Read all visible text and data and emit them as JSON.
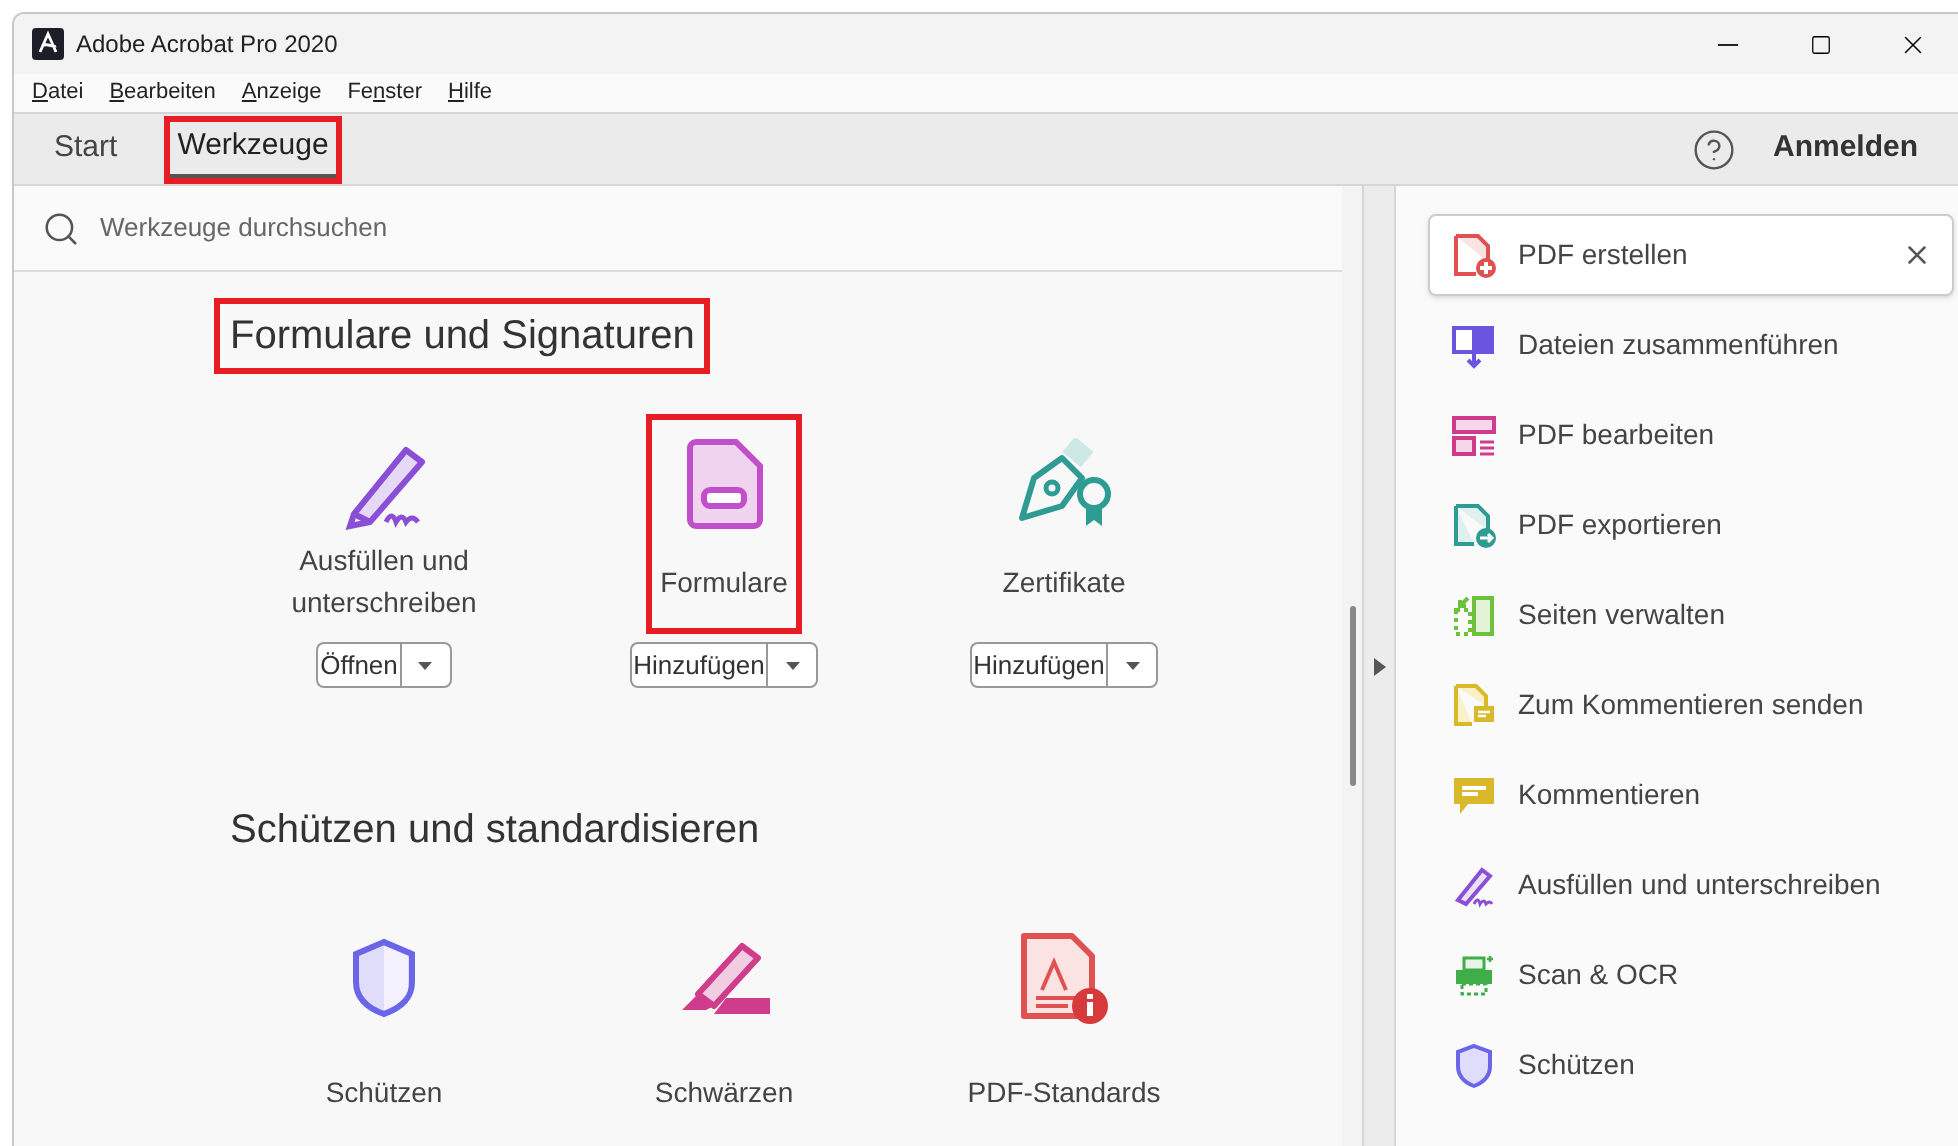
{
  "window": {
    "title": "Adobe Acrobat Pro 2020"
  },
  "menu": [
    {
      "mnemonic": "D",
      "after": "atei"
    },
    {
      "mnemonic": "B",
      "after": "earbeiten"
    },
    {
      "mnemonic": "A",
      "after": "nzeige"
    },
    {
      "before": "Fe",
      "mnemonic": "n",
      "after": "ster"
    },
    {
      "mnemonic": "H",
      "after": "ilfe"
    }
  ],
  "tabs": [
    {
      "label": "Start",
      "selected": false,
      "highlighted": false
    },
    {
      "label": "Werkzeuge",
      "selected": true,
      "highlighted": true
    }
  ],
  "sign_in": "Anmelden",
  "search": {
    "placeholder": "Werkzeuge durchsuchen"
  },
  "sections": [
    {
      "title": "Formulare und Signaturen",
      "highlighted": true,
      "tools": [
        {
          "label": "Ausfüllen und unterschreiben",
          "button": "Öffnen",
          "highlighted": false
        },
        {
          "label": "Formulare",
          "button": "Hinzufügen",
          "highlighted": true
        },
        {
          "label": "Zertifikate",
          "button": "Hinzufügen",
          "highlighted": false
        }
      ]
    },
    {
      "title": "Schützen und standardisieren",
      "highlighted": false,
      "tools": [
        {
          "label": "Schützen",
          "highlighted": false
        },
        {
          "label": "Schwärzen",
          "highlighted": false
        },
        {
          "label": "PDF-Standards",
          "highlighted": false
        }
      ]
    }
  ],
  "right_panel": [
    {
      "label": "PDF erstellen",
      "selected": true
    },
    {
      "label": "Dateien zusammenführen",
      "selected": false
    },
    {
      "label": "PDF bearbeiten",
      "selected": false
    },
    {
      "label": "PDF exportieren",
      "selected": false
    },
    {
      "label": "Seiten verwalten",
      "selected": false
    },
    {
      "label": "Zum Kommentieren senden",
      "selected": false
    },
    {
      "label": "Kommentieren",
      "selected": false
    },
    {
      "label": "Ausfüllen und unterschreiben",
      "selected": false
    },
    {
      "label": "Scan & OCR",
      "selected": false
    },
    {
      "label": "Schützen",
      "selected": false
    }
  ]
}
